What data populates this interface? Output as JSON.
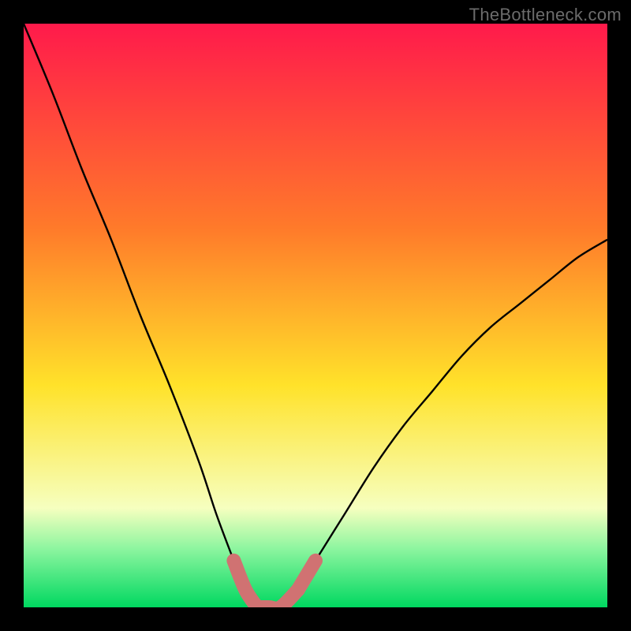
{
  "watermark": "TheBottleneck.com",
  "colors": {
    "frame": "#000000",
    "curve": "#000000",
    "accent": "#d07272",
    "gradient_top": "#ff1a4b",
    "gradient_high": "#ff7a2a",
    "gradient_mid": "#ffe22a",
    "gradient_low": "#f6ffbf",
    "gradient_band": "#8cf59f",
    "gradient_bottom": "#00d860"
  },
  "chart_data": {
    "type": "line",
    "title": "",
    "xlabel": "",
    "ylabel": "",
    "xlim": [
      0,
      100
    ],
    "ylim": [
      0,
      100
    ],
    "series": [
      {
        "name": "bottleneck-curve",
        "x": [
          0,
          5,
          10,
          15,
          20,
          25,
          30,
          33,
          36,
          38,
          40,
          42,
          44,
          47,
          50,
          55,
          60,
          65,
          70,
          75,
          80,
          85,
          90,
          95,
          100
        ],
        "y": [
          100,
          88,
          75,
          63,
          50,
          38,
          25,
          16,
          8,
          3,
          0,
          0,
          0,
          3,
          8,
          16,
          24,
          31,
          37,
          43,
          48,
          52,
          56,
          60,
          63
        ]
      }
    ],
    "annotations": [
      {
        "name": "accent-segment-left",
        "x_range": [
          35,
          40
        ],
        "desc": "pink thick segment descending into valley"
      },
      {
        "name": "accent-segment-bottom",
        "x_range": [
          40,
          47
        ],
        "desc": "pink thick flat valley floor"
      },
      {
        "name": "accent-segment-right",
        "x_range": [
          47,
          51
        ],
        "desc": "pink thick segment rising out of valley"
      }
    ],
    "background_gradient": {
      "stops": [
        {
          "offset": 0.0,
          "color_key": "gradient_top"
        },
        {
          "offset": 0.35,
          "color_key": "gradient_high"
        },
        {
          "offset": 0.62,
          "color_key": "gradient_mid"
        },
        {
          "offset": 0.83,
          "color_key": "gradient_low"
        },
        {
          "offset": 0.9,
          "color_key": "gradient_band"
        },
        {
          "offset": 1.0,
          "color_key": "gradient_bottom"
        }
      ]
    }
  }
}
